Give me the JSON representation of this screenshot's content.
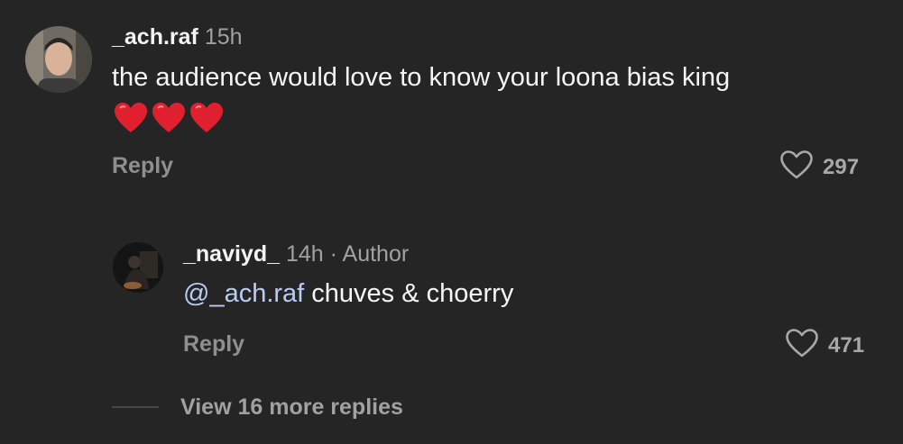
{
  "comment": {
    "username": "_ach.raf",
    "time": "15h",
    "text": "the audience would love to know your loona bias king",
    "emoji_icons": [
      "red-heart-emoji",
      "red-heart-emoji",
      "red-heart-emoji"
    ],
    "reply_label": "Reply",
    "like_count": "297"
  },
  "reply": {
    "username": "_naviyd_",
    "time": "14h",
    "separator": " · ",
    "badge": "Author",
    "mention": "@_ach.raf",
    "text": " chuves & choerry",
    "reply_label": "Reply",
    "like_count": "471"
  },
  "view_more": {
    "label": "View 16 more replies"
  },
  "colors": {
    "background": "#252525",
    "mention": "#b9cdf3",
    "heart_emoji": "#e0202f"
  }
}
